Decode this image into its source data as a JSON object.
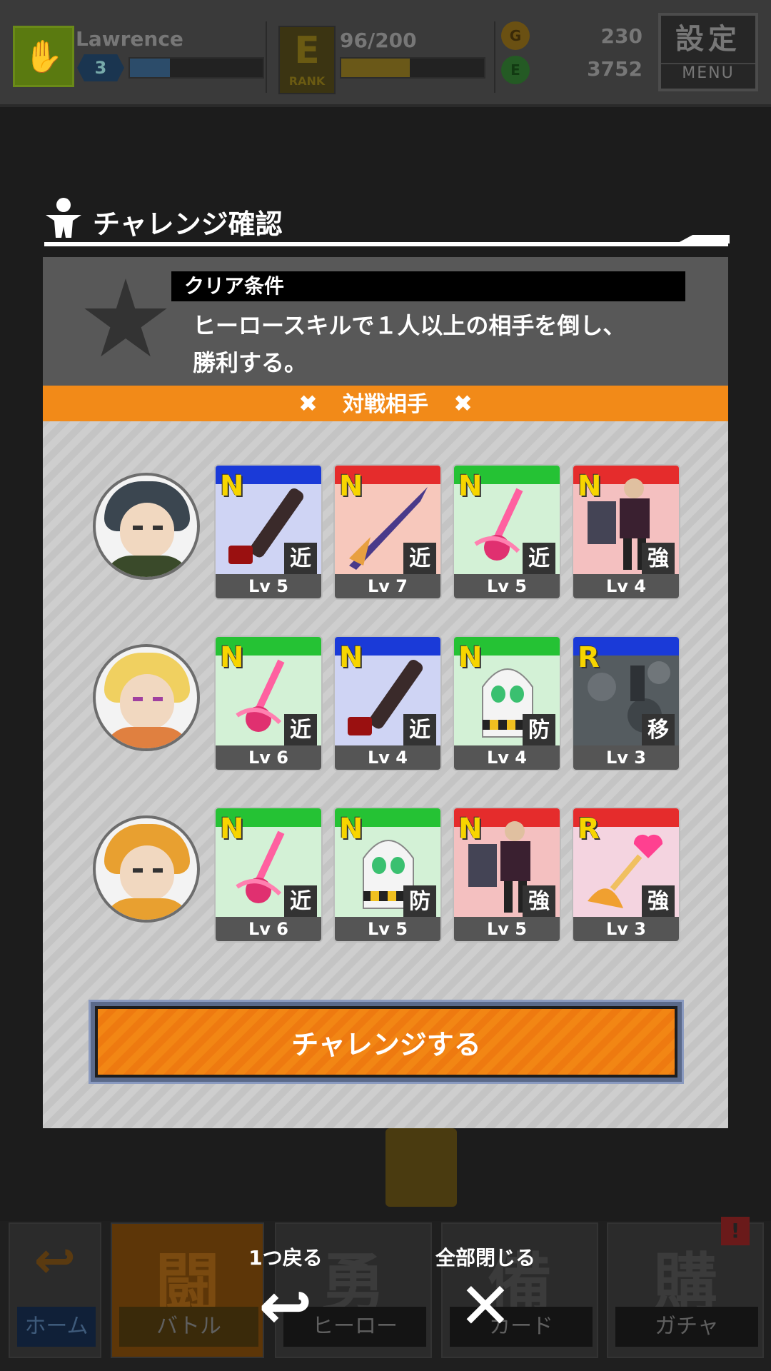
{
  "topbar": {
    "player_name": "Lawrence",
    "level": "3",
    "exp_fraction": 0.3,
    "rank_letter": "E",
    "rank_label": "RANK",
    "stamina_text": "96/200",
    "stamina_fraction": 0.48,
    "gold_coin": "230",
    "green_coin": "3752",
    "menu_kanji": "設定",
    "menu_en": "MENU"
  },
  "modal": {
    "title": "チャレンジ確認",
    "clear_header": "クリア条件",
    "clear_text_line1": "ヒーロースキルで１人以上の相手を倒し、",
    "clear_text_line2": "勝利する。",
    "opponents_label": "対戦相手",
    "x_mark": "✖",
    "challenge_button": "チャレンジする",
    "opponents": [
      {
        "cards": [
          {
            "rarity": "N",
            "type": "近",
            "level": "Lv 5",
            "band": "#1a3ad8",
            "bg": "#cfd4f4",
            "art": "chainsaw"
          },
          {
            "rarity": "N",
            "type": "近",
            "level": "Lv 7",
            "band": "#e52c2c",
            "bg": "#f7c8bc",
            "art": "claw"
          },
          {
            "rarity": "N",
            "type": "近",
            "level": "Lv 5",
            "band": "#25c234",
            "bg": "#d3f1d6",
            "art": "wand"
          },
          {
            "rarity": "N",
            "type": "強",
            "level": "Lv 4",
            "band": "#e52c2c",
            "bg": "#f4c0c0",
            "art": "gentleman"
          }
        ]
      },
      {
        "cards": [
          {
            "rarity": "N",
            "type": "近",
            "level": "Lv 6",
            "band": "#25c234",
            "bg": "#d3f1d6",
            "art": "wand"
          },
          {
            "rarity": "N",
            "type": "近",
            "level": "Lv 4",
            "band": "#1a3ad8",
            "bg": "#cfd4f4",
            "art": "chainsaw"
          },
          {
            "rarity": "N",
            "type": "防",
            "level": "Lv 4",
            "band": "#25c234",
            "bg": "#d3f1d6",
            "art": "ghost"
          },
          {
            "rarity": "R",
            "type": "移",
            "level": "Lv 3",
            "band": "#1a3ad8",
            "bg": "#5a6066",
            "art": "camo"
          }
        ]
      },
      {
        "cards": [
          {
            "rarity": "N",
            "type": "近",
            "level": "Lv 6",
            "band": "#25c234",
            "bg": "#d3f1d6",
            "art": "wand"
          },
          {
            "rarity": "N",
            "type": "防",
            "level": "Lv 5",
            "band": "#25c234",
            "bg": "#d3f1d6",
            "art": "ghost"
          },
          {
            "rarity": "N",
            "type": "強",
            "level": "Lv 5",
            "band": "#e52c2c",
            "bg": "#f4c0c0",
            "art": "gentleman"
          },
          {
            "rarity": "R",
            "type": "強",
            "level": "Lv 3",
            "band": "#e52c2c",
            "bg": "#f4d4e0",
            "art": "heartwand"
          }
        ]
      }
    ]
  },
  "controls": {
    "back_label": "1つ戻る",
    "close_label": "全部閉じる"
  },
  "nav": {
    "home": "ホーム",
    "battle": "バトル",
    "hero": "ヒーロー",
    "card": "カード",
    "gacha": "ガチャ",
    "battle_glyph": "闘",
    "hero_glyph": "勇",
    "card_glyph": "備",
    "gacha_glyph": "購",
    "alert": "!"
  },
  "colors": {
    "accent_orange": "#f28a18",
    "panel_grey": "#c9c9c9"
  }
}
